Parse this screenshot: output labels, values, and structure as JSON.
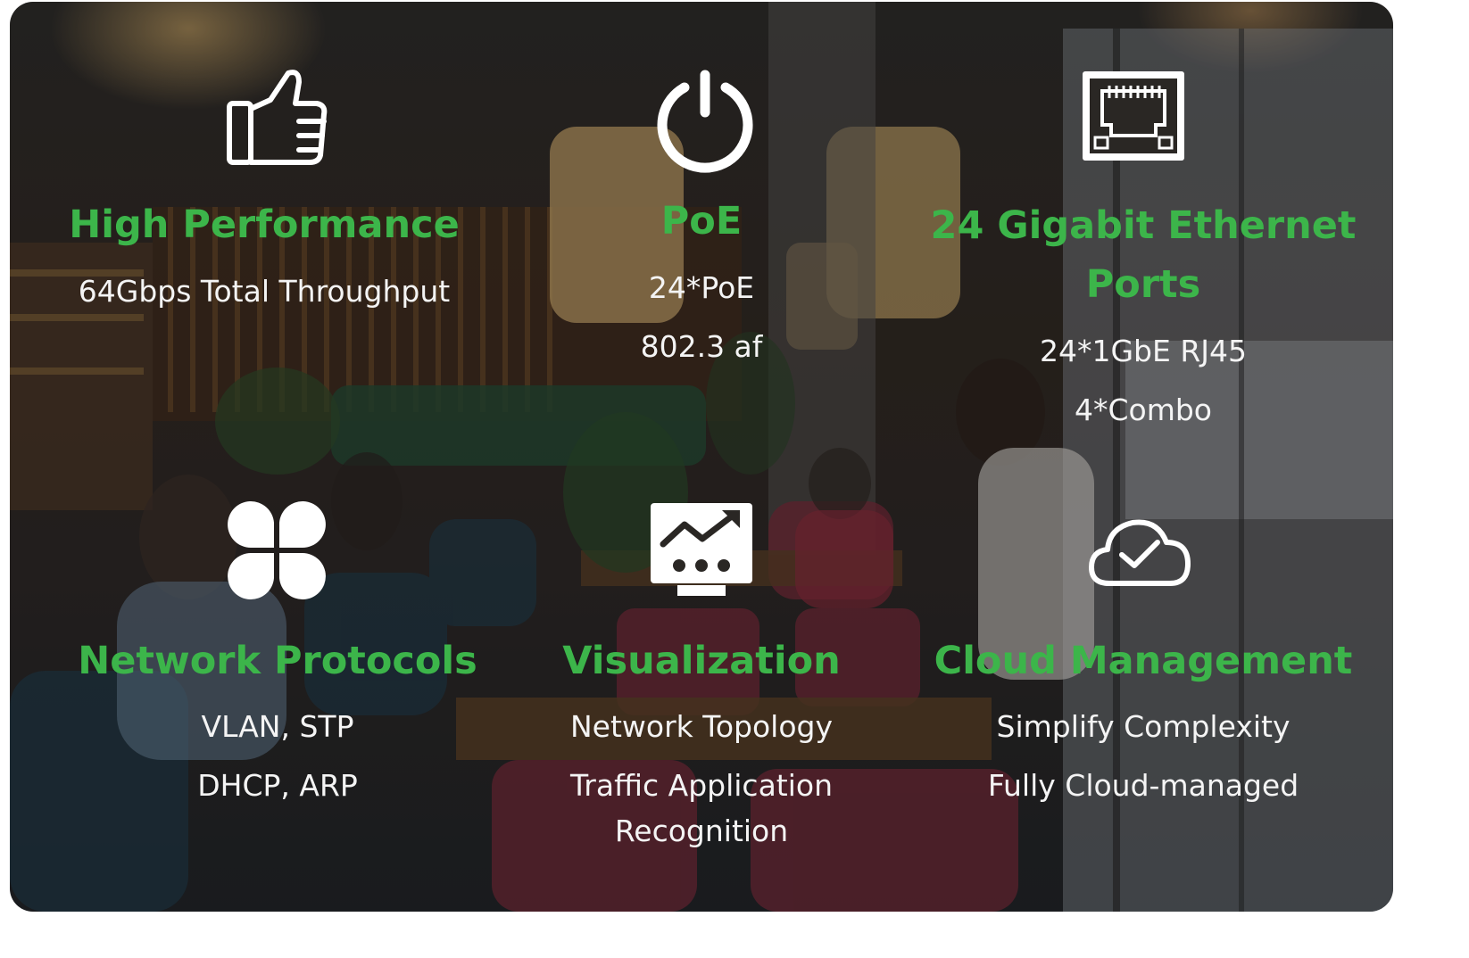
{
  "features": [
    {
      "icon": "thumbs-up-icon",
      "title": "High Performance",
      "lines": [
        "64Gbps Total Throughput"
      ]
    },
    {
      "icon": "power-icon",
      "title": "PoE",
      "lines": [
        "24*PoE",
        "802.3 af"
      ]
    },
    {
      "icon": "ethernet-port-icon",
      "title_line1": "24 Gigabit Ethernet",
      "title_line2": "Ports",
      "lines": [
        "24*1GbE RJ45",
        "4*Combo"
      ]
    },
    {
      "icon": "four-petal-icon",
      "title": "Network Protocols",
      "lines": [
        "VLAN, STP",
        "DHCP, ARP"
      ]
    },
    {
      "icon": "chart-trend-icon",
      "title": "Visualization",
      "lines": [
        "Network Topology",
        "Traffic Application",
        "Recognition"
      ]
    },
    {
      "icon": "cloud-check-icon",
      "title": "Cloud Management",
      "lines": [
        "Simplify Complexity",
        "Fully Cloud-managed"
      ]
    }
  ],
  "colors": {
    "title_green": "#3cb54a",
    "text_white": "#f4f4f4"
  }
}
